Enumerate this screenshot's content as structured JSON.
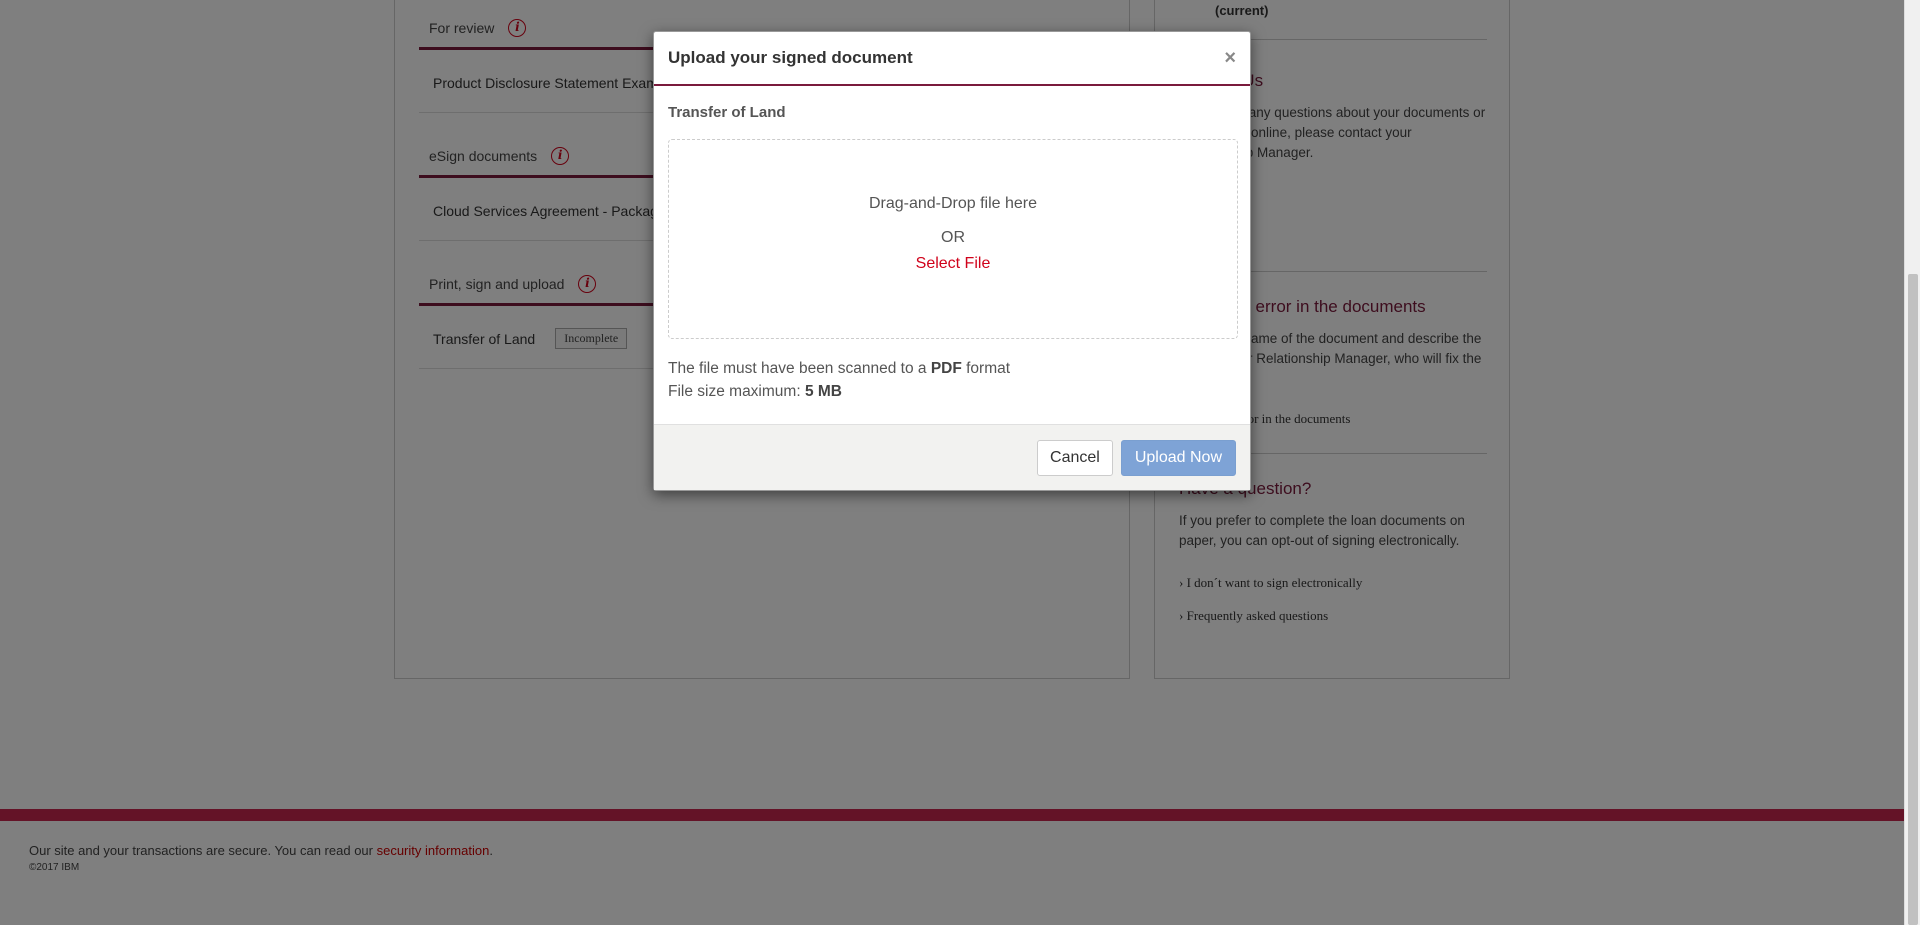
{
  "left_panel": {
    "sections": [
      {
        "title": "For review",
        "row_label": "Product Disclosure Statement Example"
      },
      {
        "title": "eSign documents",
        "row_label": "Cloud Services Agreement - Package"
      },
      {
        "title": "Print, sign and upload",
        "row_label": "Transfer of Land",
        "badge": "Incomplete"
      }
    ]
  },
  "right_panel": {
    "current_label": "(current)",
    "contact": {
      "heading": "Contact Us",
      "text": "If you have any questions about your documents or how to sign online, please contact your Relationship Manager."
    },
    "error": {
      "heading": "Found an error in the documents",
      "text": "Tell us the name of the document and describe the error to your Relationship Manager, who will fix the problem.",
      "link": "Report an error in the documents"
    },
    "question": {
      "heading": "Have a question?",
      "text": "If you prefer to complete the loan documents on paper, you can opt-out of signing electronically.",
      "links": [
        "I don´t want to sign electronically",
        "Frequently asked questions"
      ]
    }
  },
  "footer": {
    "text": "Our site and your transactions are secure. You can read our ",
    "link": "security information",
    "period": ".",
    "copyright": "©2017 IBM"
  },
  "modal": {
    "title": "Upload your signed document",
    "close": "×",
    "document_name": "Transfer of Land",
    "dropzone": {
      "drag_text": "Drag-and-Drop file here",
      "or_text": "OR",
      "select_text": "Select File"
    },
    "hint_line1_pre": "The file must have been scanned to a ",
    "hint_line1_bold": "PDF",
    "hint_line1_post": " format",
    "hint_line2_pre": "File size maximum: ",
    "hint_line2_bold": "5 MB",
    "cancel_label": "Cancel",
    "upload_label": "Upload Now"
  },
  "colors": {
    "accent": "#7a1a3c",
    "link_red": "#d0021b",
    "upload_button": "#7ea3d6",
    "footer_bar": "#c8264f"
  }
}
